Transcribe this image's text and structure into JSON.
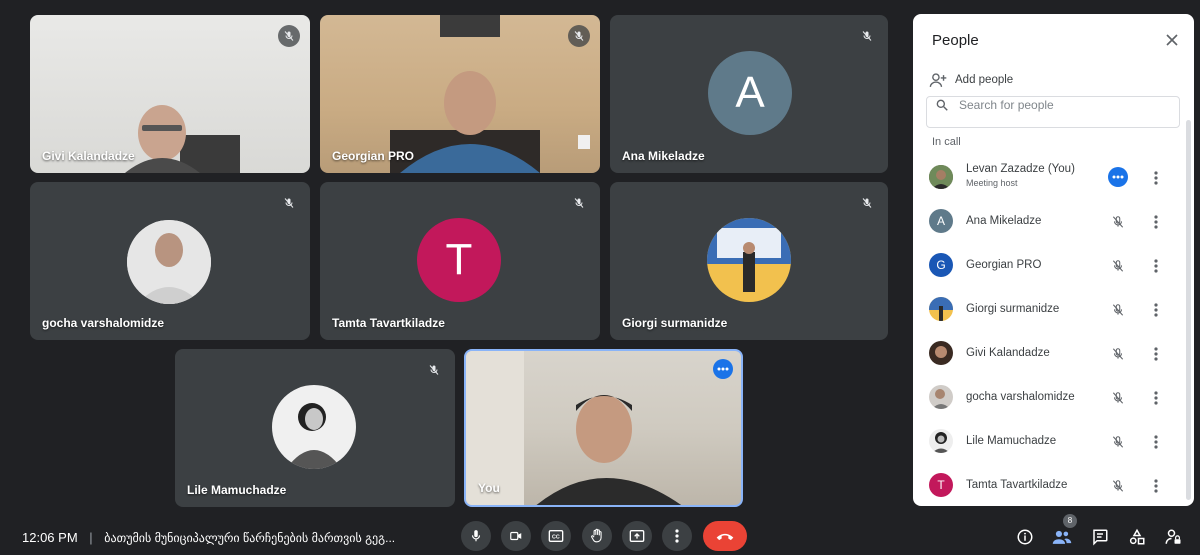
{
  "tiles": {
    "givi": {
      "name": "Givi Kalandadze"
    },
    "georgian": {
      "name": "Georgian PRO"
    },
    "ana": {
      "name": "Ana Mikeladze",
      "letter": "A",
      "color": "#5f7a8a"
    },
    "gocha": {
      "name": "gocha varshalomidze"
    },
    "tamta": {
      "name": "Tamta Tavartkiladze",
      "letter": "T",
      "color": "#c2185b"
    },
    "giorgi": {
      "name": "Giorgi surmanidze"
    },
    "lile": {
      "name": "Lile Mamuchadze"
    },
    "you": {
      "name": "You"
    }
  },
  "bottom_bar": {
    "time": "12:06 PM",
    "separator": "|",
    "meeting_title": "ბათუმის მუნიციპალური წარჩენების მართვის გეგ...",
    "people_count": "8"
  },
  "people_panel": {
    "title": "People",
    "add_people": "Add people",
    "search_placeholder": "Search for people",
    "section": "In call",
    "participants": [
      {
        "name": "Levan Zazadze (You)",
        "sub": "Meeting host",
        "avatar": "photo",
        "color": "#4a5a3a"
      },
      {
        "name": "Ana Mikeladze",
        "avatar": "A",
        "color": "#5f7a8a"
      },
      {
        "name": "Georgian PRO",
        "avatar": "G",
        "color": "#1a57b5"
      },
      {
        "name": "Giorgi surmanidze",
        "avatar": "photo",
        "color": "#5e7fb0"
      },
      {
        "name": "Givi Kalandadze",
        "avatar": "photo",
        "color": "#6b4a3a"
      },
      {
        "name": "gocha varshalomidze",
        "avatar": "photo",
        "color": "#8a7a70"
      },
      {
        "name": "Lile Mamuchadze",
        "avatar": "photo",
        "color": "#9a9a9a"
      },
      {
        "name": "Tamta Tavartkiladze",
        "avatar": "T",
        "color": "#c2185b"
      }
    ]
  }
}
